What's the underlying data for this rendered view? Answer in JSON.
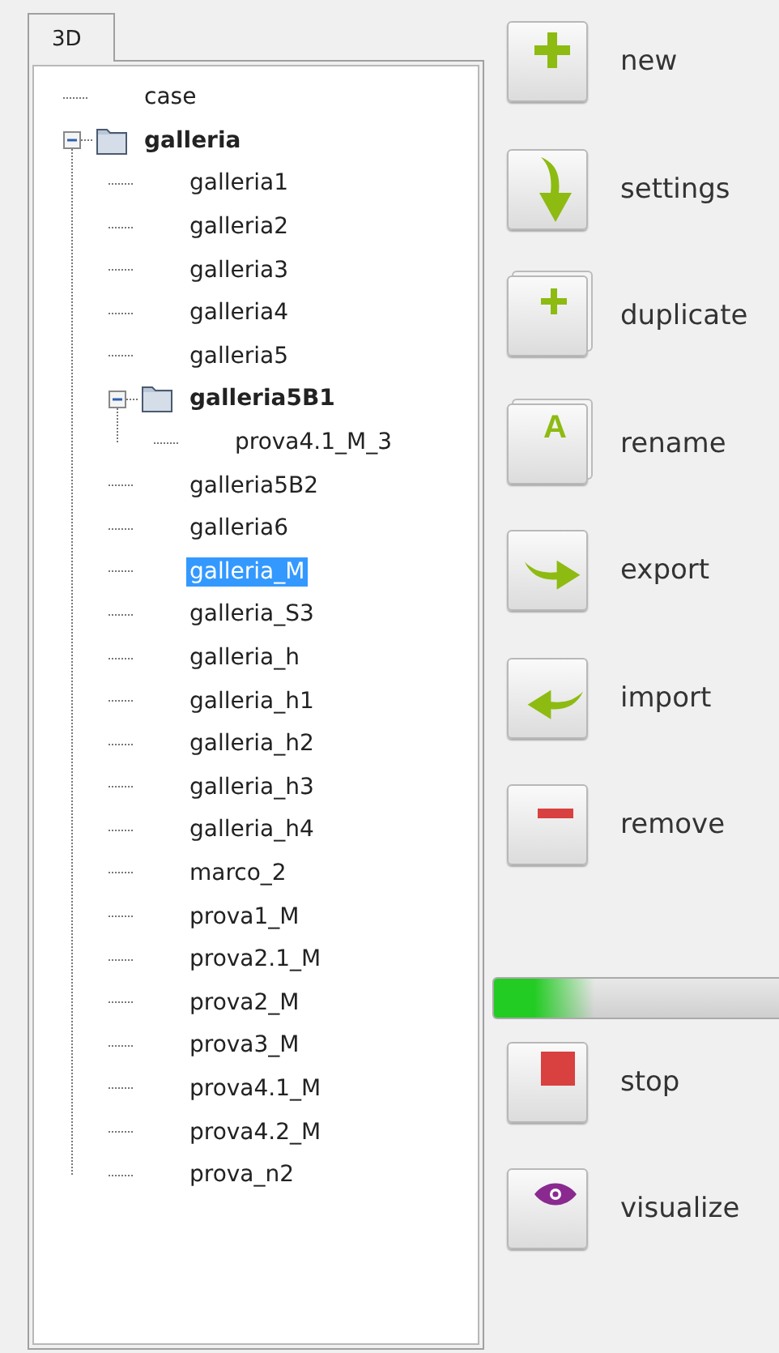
{
  "tabs": [
    {
      "label": "3D",
      "selected": true
    }
  ],
  "tree": [
    {
      "label": "case",
      "kind": "leaf",
      "selected": false
    },
    {
      "label": "galleria",
      "kind": "folder",
      "expanded": true,
      "selected": false,
      "children": [
        {
          "label": "galleria1",
          "kind": "leaf",
          "selected": false
        },
        {
          "label": "galleria2",
          "kind": "leaf",
          "selected": false
        },
        {
          "label": "galleria3",
          "kind": "leaf",
          "selected": false
        },
        {
          "label": "galleria4",
          "kind": "leaf",
          "selected": false
        },
        {
          "label": "galleria5",
          "kind": "leaf",
          "selected": false
        },
        {
          "label": "galleria5B1",
          "kind": "folder",
          "expanded": true,
          "selected": false,
          "children": [
            {
              "label": "prova4.1_M_3",
              "kind": "leaf",
              "selected": false
            }
          ]
        },
        {
          "label": "galleria5B2",
          "kind": "leaf",
          "selected": false
        },
        {
          "label": "galleria6",
          "kind": "leaf",
          "selected": false
        },
        {
          "label": "galleria_M",
          "kind": "leaf",
          "selected": true
        },
        {
          "label": "galleria_S3",
          "kind": "leaf",
          "selected": false
        },
        {
          "label": "galleria_h",
          "kind": "leaf",
          "selected": false
        },
        {
          "label": "galleria_h1",
          "kind": "leaf",
          "selected": false
        },
        {
          "label": "galleria_h2",
          "kind": "leaf",
          "selected": false
        },
        {
          "label": "galleria_h3",
          "kind": "leaf",
          "selected": false
        },
        {
          "label": "galleria_h4",
          "kind": "leaf",
          "selected": false
        },
        {
          "label": "marco_2",
          "kind": "leaf",
          "selected": false
        },
        {
          "label": "prova1_M",
          "kind": "leaf",
          "selected": false
        },
        {
          "label": "prova2.1_M",
          "kind": "leaf",
          "selected": false
        },
        {
          "label": "prova2_M",
          "kind": "leaf",
          "selected": false
        },
        {
          "label": "prova3_M",
          "kind": "leaf",
          "selected": false
        },
        {
          "label": "prova4.1_M",
          "kind": "leaf",
          "selected": false
        },
        {
          "label": "prova4.2_M",
          "kind": "leaf",
          "selected": false
        },
        {
          "label": "prova_n2",
          "kind": "leaf",
          "selected": false
        }
      ]
    }
  ],
  "actions": [
    {
      "kind": "plus",
      "label": "new"
    },
    {
      "kind": "down",
      "label": "settings"
    },
    {
      "kind": "duplicate",
      "label": "duplicate"
    },
    {
      "kind": "rename",
      "glyph": "A",
      "label": "rename"
    },
    {
      "kind": "export",
      "label": "export"
    },
    {
      "kind": "import",
      "label": "import"
    },
    {
      "kind": "remove",
      "label": "remove"
    }
  ],
  "progress": {
    "level": 0.35
  },
  "run_actions": [
    {
      "kind": "stop",
      "label": "stop"
    },
    {
      "kind": "eye",
      "label": "visualize"
    }
  ]
}
